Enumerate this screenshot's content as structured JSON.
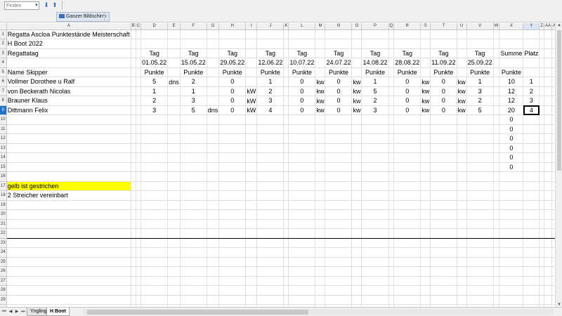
{
  "toolbar": {
    "find_placeholder": "Finden",
    "fullscreen_label": "Ganzer Bildschirm"
  },
  "columns": [
    "A",
    "B",
    "C",
    "D",
    "E",
    "F",
    "G",
    "H",
    "I",
    "J",
    "K",
    "L",
    "M",
    "N",
    "O",
    "P",
    "Q",
    "R",
    "S",
    "T",
    "U",
    "V",
    "W",
    "X",
    "Y",
    "Z",
    "AA",
    "AB"
  ],
  "active_cell": "Y9",
  "sheet": {
    "title": "Regatta Ascloa   Punktestände Meisterschaft",
    "boat": "H Boot 2022",
    "row3": {
      "label": "Regattatag",
      "days": [
        "Tag",
        "Tag",
        "Tag",
        "Tag",
        "Tag",
        "Tag",
        "Tag",
        "Tag",
        "Tag",
        "Tag"
      ],
      "summe": "Summe",
      "platz": "Platz"
    },
    "dates": [
      "01.05.22",
      "15.05.22",
      "29.05.22",
      "12.06.22",
      "10.07.22",
      "24.07.22",
      "14.08.22",
      "28.08.22",
      "11.09.22",
      "25.09.22"
    ],
    "row5": {
      "label": "Name Skipper",
      "punkte": [
        "Punkte",
        "Punkte",
        "Punkte",
        "Punkte",
        "Punkte",
        "Punkte",
        "Punkte",
        "Punkte",
        "Punkte",
        "Punkte",
        "Punkte"
      ]
    },
    "skippers": [
      {
        "name": "Vollmer Dorothee u Ralf",
        "points": [
          "5",
          "2",
          "0",
          "1",
          "0",
          "0",
          "1",
          "0",
          "0",
          "1"
        ],
        "notes": [
          "dns",
          "",
          "",
          "",
          "kw",
          "kw",
          "",
          "kw",
          "kw",
          ""
        ],
        "sum": "10",
        "place": "1"
      },
      {
        "name": "von Beckerath Nicolas",
        "points": [
          "1",
          "1",
          "0",
          "2",
          "0",
          "0",
          "5",
          "0",
          "0",
          "3"
        ],
        "notes": [
          "",
          "",
          "kW",
          "",
          "kw",
          "kw",
          "",
          "kw",
          "kw",
          ""
        ],
        "sum": "12",
        "place": "2"
      },
      {
        "name": "Brauner Klaus",
        "points": [
          "2",
          "3",
          "0",
          "3",
          "0",
          "0",
          "2",
          "0",
          "0",
          "2"
        ],
        "notes": [
          "",
          "",
          "kW",
          "",
          "kw",
          "kw",
          "",
          "kw",
          "kw",
          ""
        ],
        "sum": "12",
        "place": "3"
      },
      {
        "name": "Dittmann Felix",
        "points": [
          "3",
          "5",
          "0",
          "4",
          "0",
          "0",
          "3",
          "0",
          "0",
          "5"
        ],
        "notes": [
          "",
          "dns",
          "kW",
          "",
          "kw",
          "kw",
          "",
          "kw",
          "kw",
          ""
        ],
        "sum": "20",
        "place": "4"
      }
    ],
    "zero_sums": [
      "0",
      "0",
      "0",
      "0",
      "0",
      "0"
    ],
    "note1": "gelb ist gestrichen",
    "note2": "2 Streicher vereinbart"
  },
  "sheet_tabs": [
    "Yngling",
    "H Boot"
  ],
  "active_tab": "H Boot"
}
